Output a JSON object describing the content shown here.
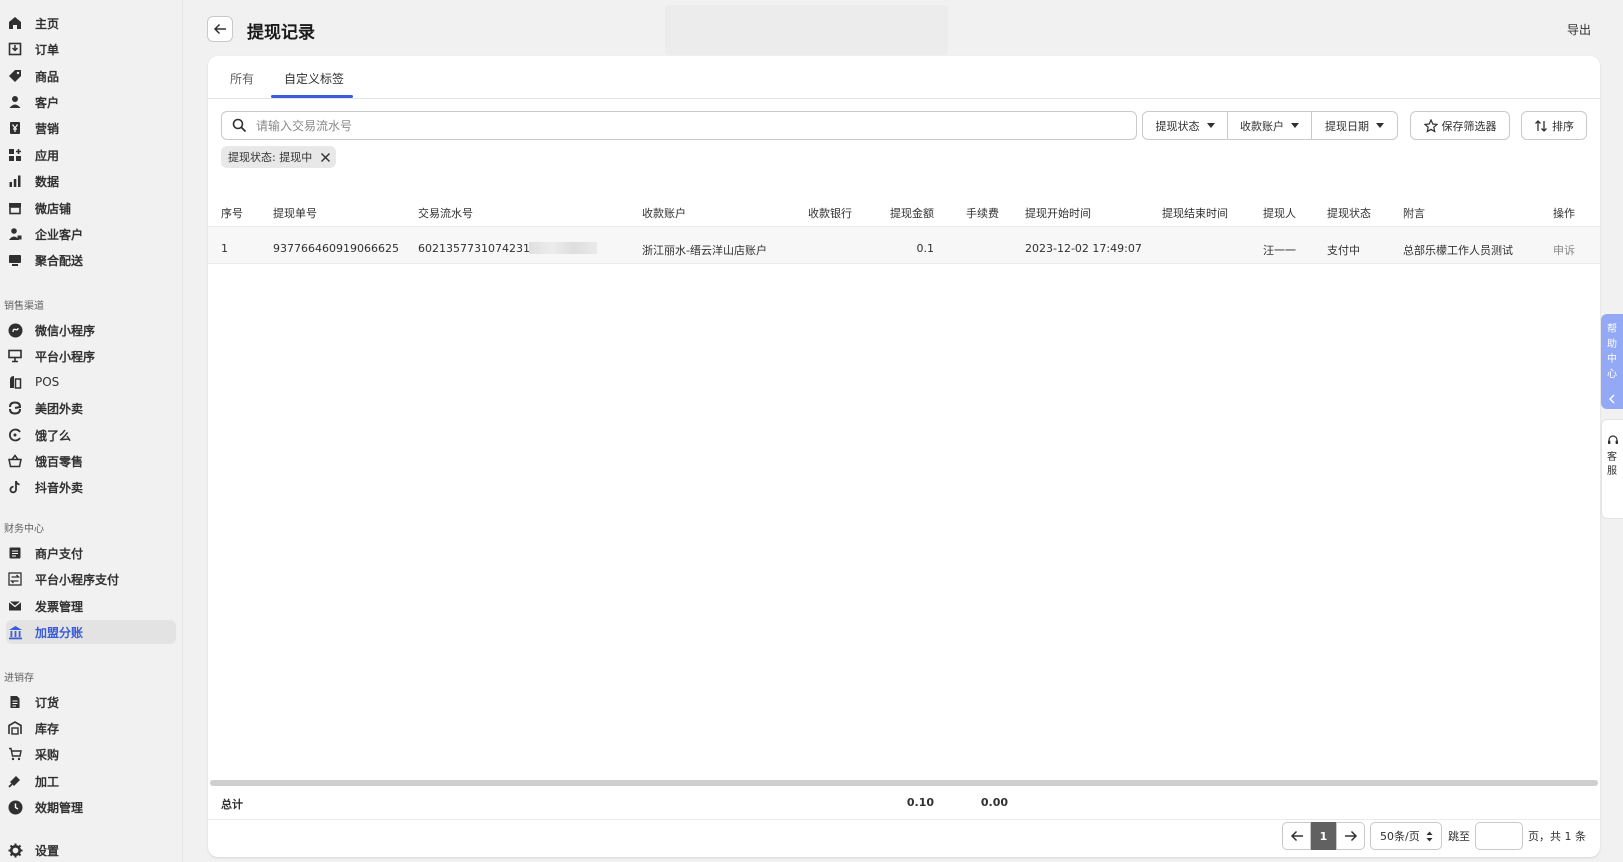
{
  "sidebar": {
    "main": [
      {
        "label": "主页",
        "icon": "home-icon"
      },
      {
        "label": "订单",
        "icon": "order-icon"
      },
      {
        "label": "商品",
        "icon": "tag-icon"
      },
      {
        "label": "客户",
        "icon": "person-icon"
      },
      {
        "label": "营销",
        "icon": "yen-icon"
      },
      {
        "label": "应用",
        "icon": "apps-icon"
      },
      {
        "label": "数据",
        "icon": "bar-chart-icon"
      },
      {
        "label": "微店铺",
        "icon": "store-icon"
      },
      {
        "label": "企业客户",
        "icon": "enterprise-customer-icon"
      },
      {
        "label": "聚合配送",
        "icon": "delivery-icon"
      }
    ],
    "sales_title": "销售渠道",
    "sales": [
      {
        "label": "微信小程序",
        "icon": "miniprogram-icon"
      },
      {
        "label": "平台小程序",
        "icon": "platform-icon"
      },
      {
        "label": "POS",
        "icon": "pos-icon"
      },
      {
        "label": "美团外卖",
        "icon": "meituan-icon"
      },
      {
        "label": "饿了么",
        "icon": "eleme-icon"
      },
      {
        "label": "饿百零售",
        "icon": "basket-icon"
      },
      {
        "label": "抖音外卖",
        "icon": "douyin-icon"
      }
    ],
    "finance_title": "财务中心",
    "finance": [
      {
        "label": "商户支付",
        "icon": "document-icon"
      },
      {
        "label": "平台小程序支付",
        "icon": "transfer-icon"
      },
      {
        "label": "发票管理",
        "icon": "invoice-icon"
      },
      {
        "label": "加盟分账",
        "icon": "bank-icon"
      }
    ],
    "inventory_title": "进销存",
    "inventory": [
      {
        "label": "订货",
        "icon": "clipboard-icon"
      },
      {
        "label": "库存",
        "icon": "warehouse-icon"
      },
      {
        "label": "采购",
        "icon": "cart-icon"
      },
      {
        "label": "加工",
        "icon": "process-icon"
      },
      {
        "label": "效期管理",
        "icon": "clock-icon"
      }
    ],
    "settings": {
      "label": "设置",
      "icon": "gear-icon"
    }
  },
  "header": {
    "title": "提现记录",
    "export": "导出"
  },
  "tabs": [
    "所有",
    "自定义标签"
  ],
  "search": {
    "placeholder": "请输入交易流水号"
  },
  "filters": [
    "提现状态",
    "收款账户",
    "提现日期"
  ],
  "save_filter": "保存筛选器",
  "sort": "排序",
  "chip": "提现状态: 提现中",
  "table": {
    "headers": [
      "序号",
      "提现单号",
      "交易流水号",
      "收款账户",
      "收款银行",
      "提现金额",
      "手续费",
      "提现开始时间",
      "提现结束时间",
      "提现人",
      "提现状态",
      "附言",
      "操作"
    ],
    "rows": [
      {
        "idx": "1",
        "order_no": "937766460919066625",
        "txn_no": "602135773107423120",
        "account": "浙江丽水-缙云洋山店账户",
        "bank": "",
        "amount": "0.1",
        "fee": "",
        "start": "2023-12-02 17:49:07",
        "end": "",
        "person": "汪一一",
        "status": "支付中",
        "note": "总部乐檬工作人员测试",
        "action": "申诉"
      }
    ],
    "total": {
      "label": "总计",
      "amount": "0.10",
      "fee": "0.00"
    }
  },
  "pagination": {
    "current": "1",
    "per_page": "50条/页",
    "jump_label": "跳至",
    "suffix": "页，共 1 条"
  },
  "float": {
    "help": "帮助中心",
    "service": "客服"
  }
}
